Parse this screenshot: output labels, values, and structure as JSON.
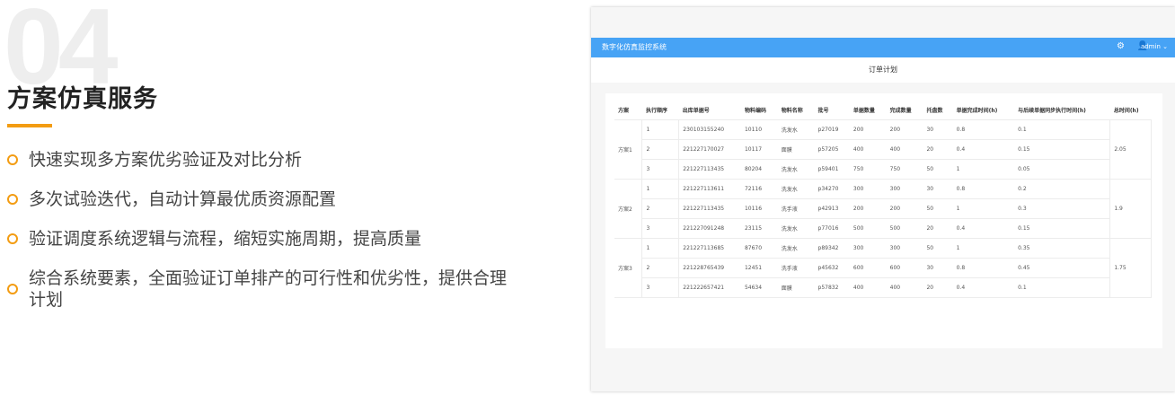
{
  "section": {
    "number": "04",
    "title": "方案仿真服务",
    "bullets": [
      "快速实现多方案优劣验证及对比分析",
      "多次试验迭代，自动计算最优质资源配置",
      "验证调度系统逻辑与流程，缩短实施周期，提高质量",
      "综合系统要素，全面验证订单排产的可行性和优劣性，提供合理计划"
    ]
  },
  "app": {
    "title": "数字化仿真监控系统",
    "user": "admin",
    "page_title": "订单计划",
    "colors": {
      "header": "#47a3f5",
      "accent": "#f39c12"
    },
    "icons": {
      "settings": "gear-icon",
      "user": "user-icon",
      "dropdown": "chevron-down-icon"
    }
  },
  "table": {
    "headers": [
      "方案",
      "执行顺序",
      "出库单据号",
      "物料编码",
      "物料名称",
      "批号",
      "单据数量",
      "完成数量",
      "托盘数",
      "单据完成时间(h)",
      "与后续单据同步执行时间(h)",
      "总时间(h)"
    ],
    "groups": [
      {
        "plan": "方案1",
        "total": "2.05",
        "rows": [
          [
            "1",
            "230103155240",
            "10110",
            "洗发水",
            "p27019",
            "200",
            "200",
            "30",
            "0.8",
            "0.1"
          ],
          [
            "2",
            "221227170027",
            "10117",
            "面膜",
            "p57205",
            "400",
            "400",
            "20",
            "0.4",
            "0.15"
          ],
          [
            "3",
            "221227113435",
            "80204",
            "洗发水",
            "p59401",
            "750",
            "750",
            "50",
            "1",
            "0.05"
          ]
        ]
      },
      {
        "plan": "方案2",
        "total": "1.9",
        "rows": [
          [
            "1",
            "221227113611",
            "72116",
            "洗发水",
            "p34270",
            "300",
            "300",
            "30",
            "0.8",
            "0.2"
          ],
          [
            "2",
            "221227113435",
            "10116",
            "洗手液",
            "p42913",
            "200",
            "200",
            "50",
            "1",
            "0.3"
          ],
          [
            "3",
            "221227091248",
            "23115",
            "洗发水",
            "p77016",
            "500",
            "500",
            "20",
            "0.4",
            "0.15"
          ]
        ]
      },
      {
        "plan": "方案3",
        "total": "1.75",
        "rows": [
          [
            "1",
            "221227113685",
            "87670",
            "洗发水",
            "p89342",
            "300",
            "300",
            "50",
            "1",
            "0.35"
          ],
          [
            "2",
            "221228765439",
            "12451",
            "洗手液",
            "p45632",
            "600",
            "600",
            "30",
            "0.8",
            "0.45"
          ],
          [
            "3",
            "221222657421",
            "54634",
            "面膜",
            "p57832",
            "400",
            "400",
            "20",
            "0.4",
            "0.1"
          ]
        ]
      }
    ]
  }
}
